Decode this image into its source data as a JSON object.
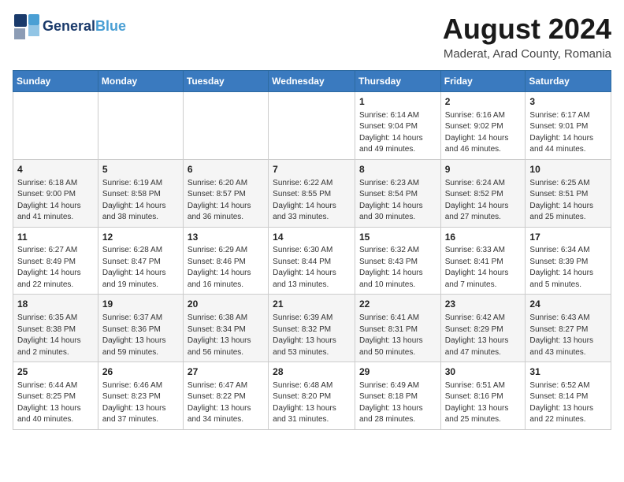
{
  "logo": {
    "line1": "General",
    "line2": "Blue"
  },
  "title": "August 2024",
  "location": "Maderat, Arad County, Romania",
  "days_of_week": [
    "Sunday",
    "Monday",
    "Tuesday",
    "Wednesday",
    "Thursday",
    "Friday",
    "Saturday"
  ],
  "weeks": [
    [
      {
        "day": "",
        "info": ""
      },
      {
        "day": "",
        "info": ""
      },
      {
        "day": "",
        "info": ""
      },
      {
        "day": "",
        "info": ""
      },
      {
        "day": "1",
        "info": "Sunrise: 6:14 AM\nSunset: 9:04 PM\nDaylight: 14 hours\nand 49 minutes."
      },
      {
        "day": "2",
        "info": "Sunrise: 6:16 AM\nSunset: 9:02 PM\nDaylight: 14 hours\nand 46 minutes."
      },
      {
        "day": "3",
        "info": "Sunrise: 6:17 AM\nSunset: 9:01 PM\nDaylight: 14 hours\nand 44 minutes."
      }
    ],
    [
      {
        "day": "4",
        "info": "Sunrise: 6:18 AM\nSunset: 9:00 PM\nDaylight: 14 hours\nand 41 minutes."
      },
      {
        "day": "5",
        "info": "Sunrise: 6:19 AM\nSunset: 8:58 PM\nDaylight: 14 hours\nand 38 minutes."
      },
      {
        "day": "6",
        "info": "Sunrise: 6:20 AM\nSunset: 8:57 PM\nDaylight: 14 hours\nand 36 minutes."
      },
      {
        "day": "7",
        "info": "Sunrise: 6:22 AM\nSunset: 8:55 PM\nDaylight: 14 hours\nand 33 minutes."
      },
      {
        "day": "8",
        "info": "Sunrise: 6:23 AM\nSunset: 8:54 PM\nDaylight: 14 hours\nand 30 minutes."
      },
      {
        "day": "9",
        "info": "Sunrise: 6:24 AM\nSunset: 8:52 PM\nDaylight: 14 hours\nand 27 minutes."
      },
      {
        "day": "10",
        "info": "Sunrise: 6:25 AM\nSunset: 8:51 PM\nDaylight: 14 hours\nand 25 minutes."
      }
    ],
    [
      {
        "day": "11",
        "info": "Sunrise: 6:27 AM\nSunset: 8:49 PM\nDaylight: 14 hours\nand 22 minutes."
      },
      {
        "day": "12",
        "info": "Sunrise: 6:28 AM\nSunset: 8:47 PM\nDaylight: 14 hours\nand 19 minutes."
      },
      {
        "day": "13",
        "info": "Sunrise: 6:29 AM\nSunset: 8:46 PM\nDaylight: 14 hours\nand 16 minutes."
      },
      {
        "day": "14",
        "info": "Sunrise: 6:30 AM\nSunset: 8:44 PM\nDaylight: 14 hours\nand 13 minutes."
      },
      {
        "day": "15",
        "info": "Sunrise: 6:32 AM\nSunset: 8:43 PM\nDaylight: 14 hours\nand 10 minutes."
      },
      {
        "day": "16",
        "info": "Sunrise: 6:33 AM\nSunset: 8:41 PM\nDaylight: 14 hours\nand 7 minutes."
      },
      {
        "day": "17",
        "info": "Sunrise: 6:34 AM\nSunset: 8:39 PM\nDaylight: 14 hours\nand 5 minutes."
      }
    ],
    [
      {
        "day": "18",
        "info": "Sunrise: 6:35 AM\nSunset: 8:38 PM\nDaylight: 14 hours\nand 2 minutes."
      },
      {
        "day": "19",
        "info": "Sunrise: 6:37 AM\nSunset: 8:36 PM\nDaylight: 13 hours\nand 59 minutes."
      },
      {
        "day": "20",
        "info": "Sunrise: 6:38 AM\nSunset: 8:34 PM\nDaylight: 13 hours\nand 56 minutes."
      },
      {
        "day": "21",
        "info": "Sunrise: 6:39 AM\nSunset: 8:32 PM\nDaylight: 13 hours\nand 53 minutes."
      },
      {
        "day": "22",
        "info": "Sunrise: 6:41 AM\nSunset: 8:31 PM\nDaylight: 13 hours\nand 50 minutes."
      },
      {
        "day": "23",
        "info": "Sunrise: 6:42 AM\nSunset: 8:29 PM\nDaylight: 13 hours\nand 47 minutes."
      },
      {
        "day": "24",
        "info": "Sunrise: 6:43 AM\nSunset: 8:27 PM\nDaylight: 13 hours\nand 43 minutes."
      }
    ],
    [
      {
        "day": "25",
        "info": "Sunrise: 6:44 AM\nSunset: 8:25 PM\nDaylight: 13 hours\nand 40 minutes."
      },
      {
        "day": "26",
        "info": "Sunrise: 6:46 AM\nSunset: 8:23 PM\nDaylight: 13 hours\nand 37 minutes."
      },
      {
        "day": "27",
        "info": "Sunrise: 6:47 AM\nSunset: 8:22 PM\nDaylight: 13 hours\nand 34 minutes."
      },
      {
        "day": "28",
        "info": "Sunrise: 6:48 AM\nSunset: 8:20 PM\nDaylight: 13 hours\nand 31 minutes."
      },
      {
        "day": "29",
        "info": "Sunrise: 6:49 AM\nSunset: 8:18 PM\nDaylight: 13 hours\nand 28 minutes."
      },
      {
        "day": "30",
        "info": "Sunrise: 6:51 AM\nSunset: 8:16 PM\nDaylight: 13 hours\nand 25 minutes."
      },
      {
        "day": "31",
        "info": "Sunrise: 6:52 AM\nSunset: 8:14 PM\nDaylight: 13 hours\nand 22 minutes."
      }
    ]
  ]
}
